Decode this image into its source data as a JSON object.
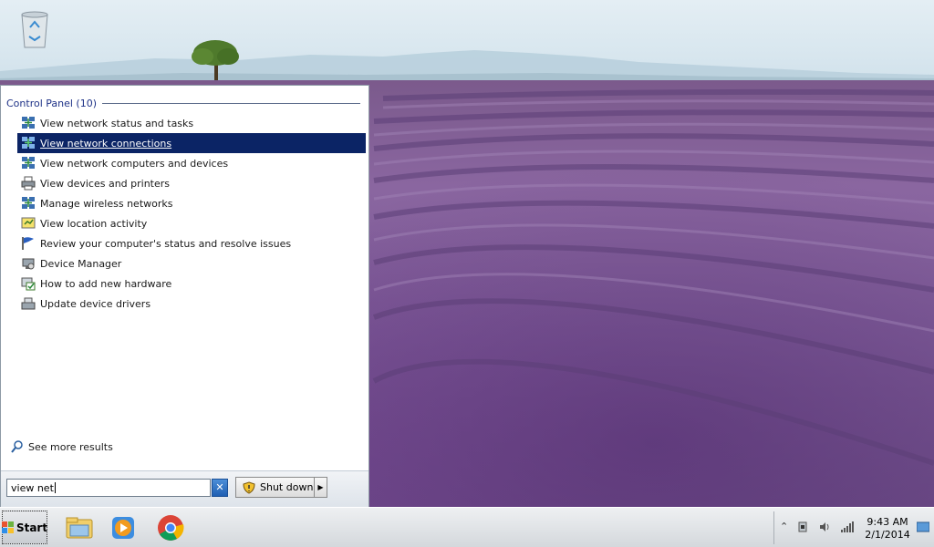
{
  "start_menu": {
    "group_title": "Control Panel (10)",
    "results": [
      {
        "label": "View network status and tasks",
        "icon": "network-icon"
      },
      {
        "label": "View network connections",
        "icon": "network-icon",
        "selected": true
      },
      {
        "label": "View network computers and devices",
        "icon": "network-icon"
      },
      {
        "label": "View devices and printers",
        "icon": "printer-icon"
      },
      {
        "label": "Manage wireless networks",
        "icon": "network-icon"
      },
      {
        "label": "View location activity",
        "icon": "location-icon"
      },
      {
        "label": "Review your computer's status and resolve issues",
        "icon": "action-center-flag-icon"
      },
      {
        "label": "Device Manager",
        "icon": "device-manager-icon"
      },
      {
        "label": "How to add new hardware",
        "icon": "hardware-icon"
      },
      {
        "label": "Update device drivers",
        "icon": "driver-icon"
      }
    ],
    "see_more": "See more results",
    "search_value": "view net",
    "shutdown_label": "Shut down"
  },
  "taskbar": {
    "start_label": "Start",
    "clock_time": "9:43 AM",
    "clock_date": "2/1/2014"
  },
  "colors": {
    "selection": "#0b2465",
    "group_header": "#1e3287"
  }
}
